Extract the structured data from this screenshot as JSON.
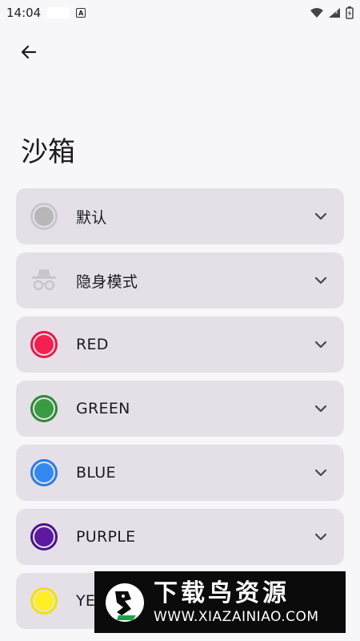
{
  "status": {
    "time": "14:04"
  },
  "page": {
    "title": "沙箱"
  },
  "items": [
    {
      "label": "默认",
      "icon": "circle-icon",
      "ring": "#c8c6c9",
      "dot": "#b8b6b9"
    },
    {
      "label": "隐身模式",
      "icon": "incognito-icon",
      "color": "#c9c6cb"
    },
    {
      "label": "RED",
      "icon": "circle-icon",
      "ring": "#e8194a",
      "dot": "#f21f50"
    },
    {
      "label": "GREEN",
      "icon": "circle-icon",
      "ring": "#2f8a36",
      "dot": "#3a9a3f"
    },
    {
      "label": "BLUE",
      "icon": "circle-icon",
      "ring": "#2a7de0",
      "dot": "#3388f0"
    },
    {
      "label": "PURPLE",
      "icon": "circle-icon",
      "ring": "#4a148c",
      "dot": "#5b1aa0"
    },
    {
      "label": "YE",
      "icon": "circle-icon",
      "ring": "#f2e200",
      "dot": "#ffee22"
    }
  ],
  "watermark": {
    "title": "下载鸟资源",
    "url": "WWW.XIAZAINIAO.COM"
  }
}
